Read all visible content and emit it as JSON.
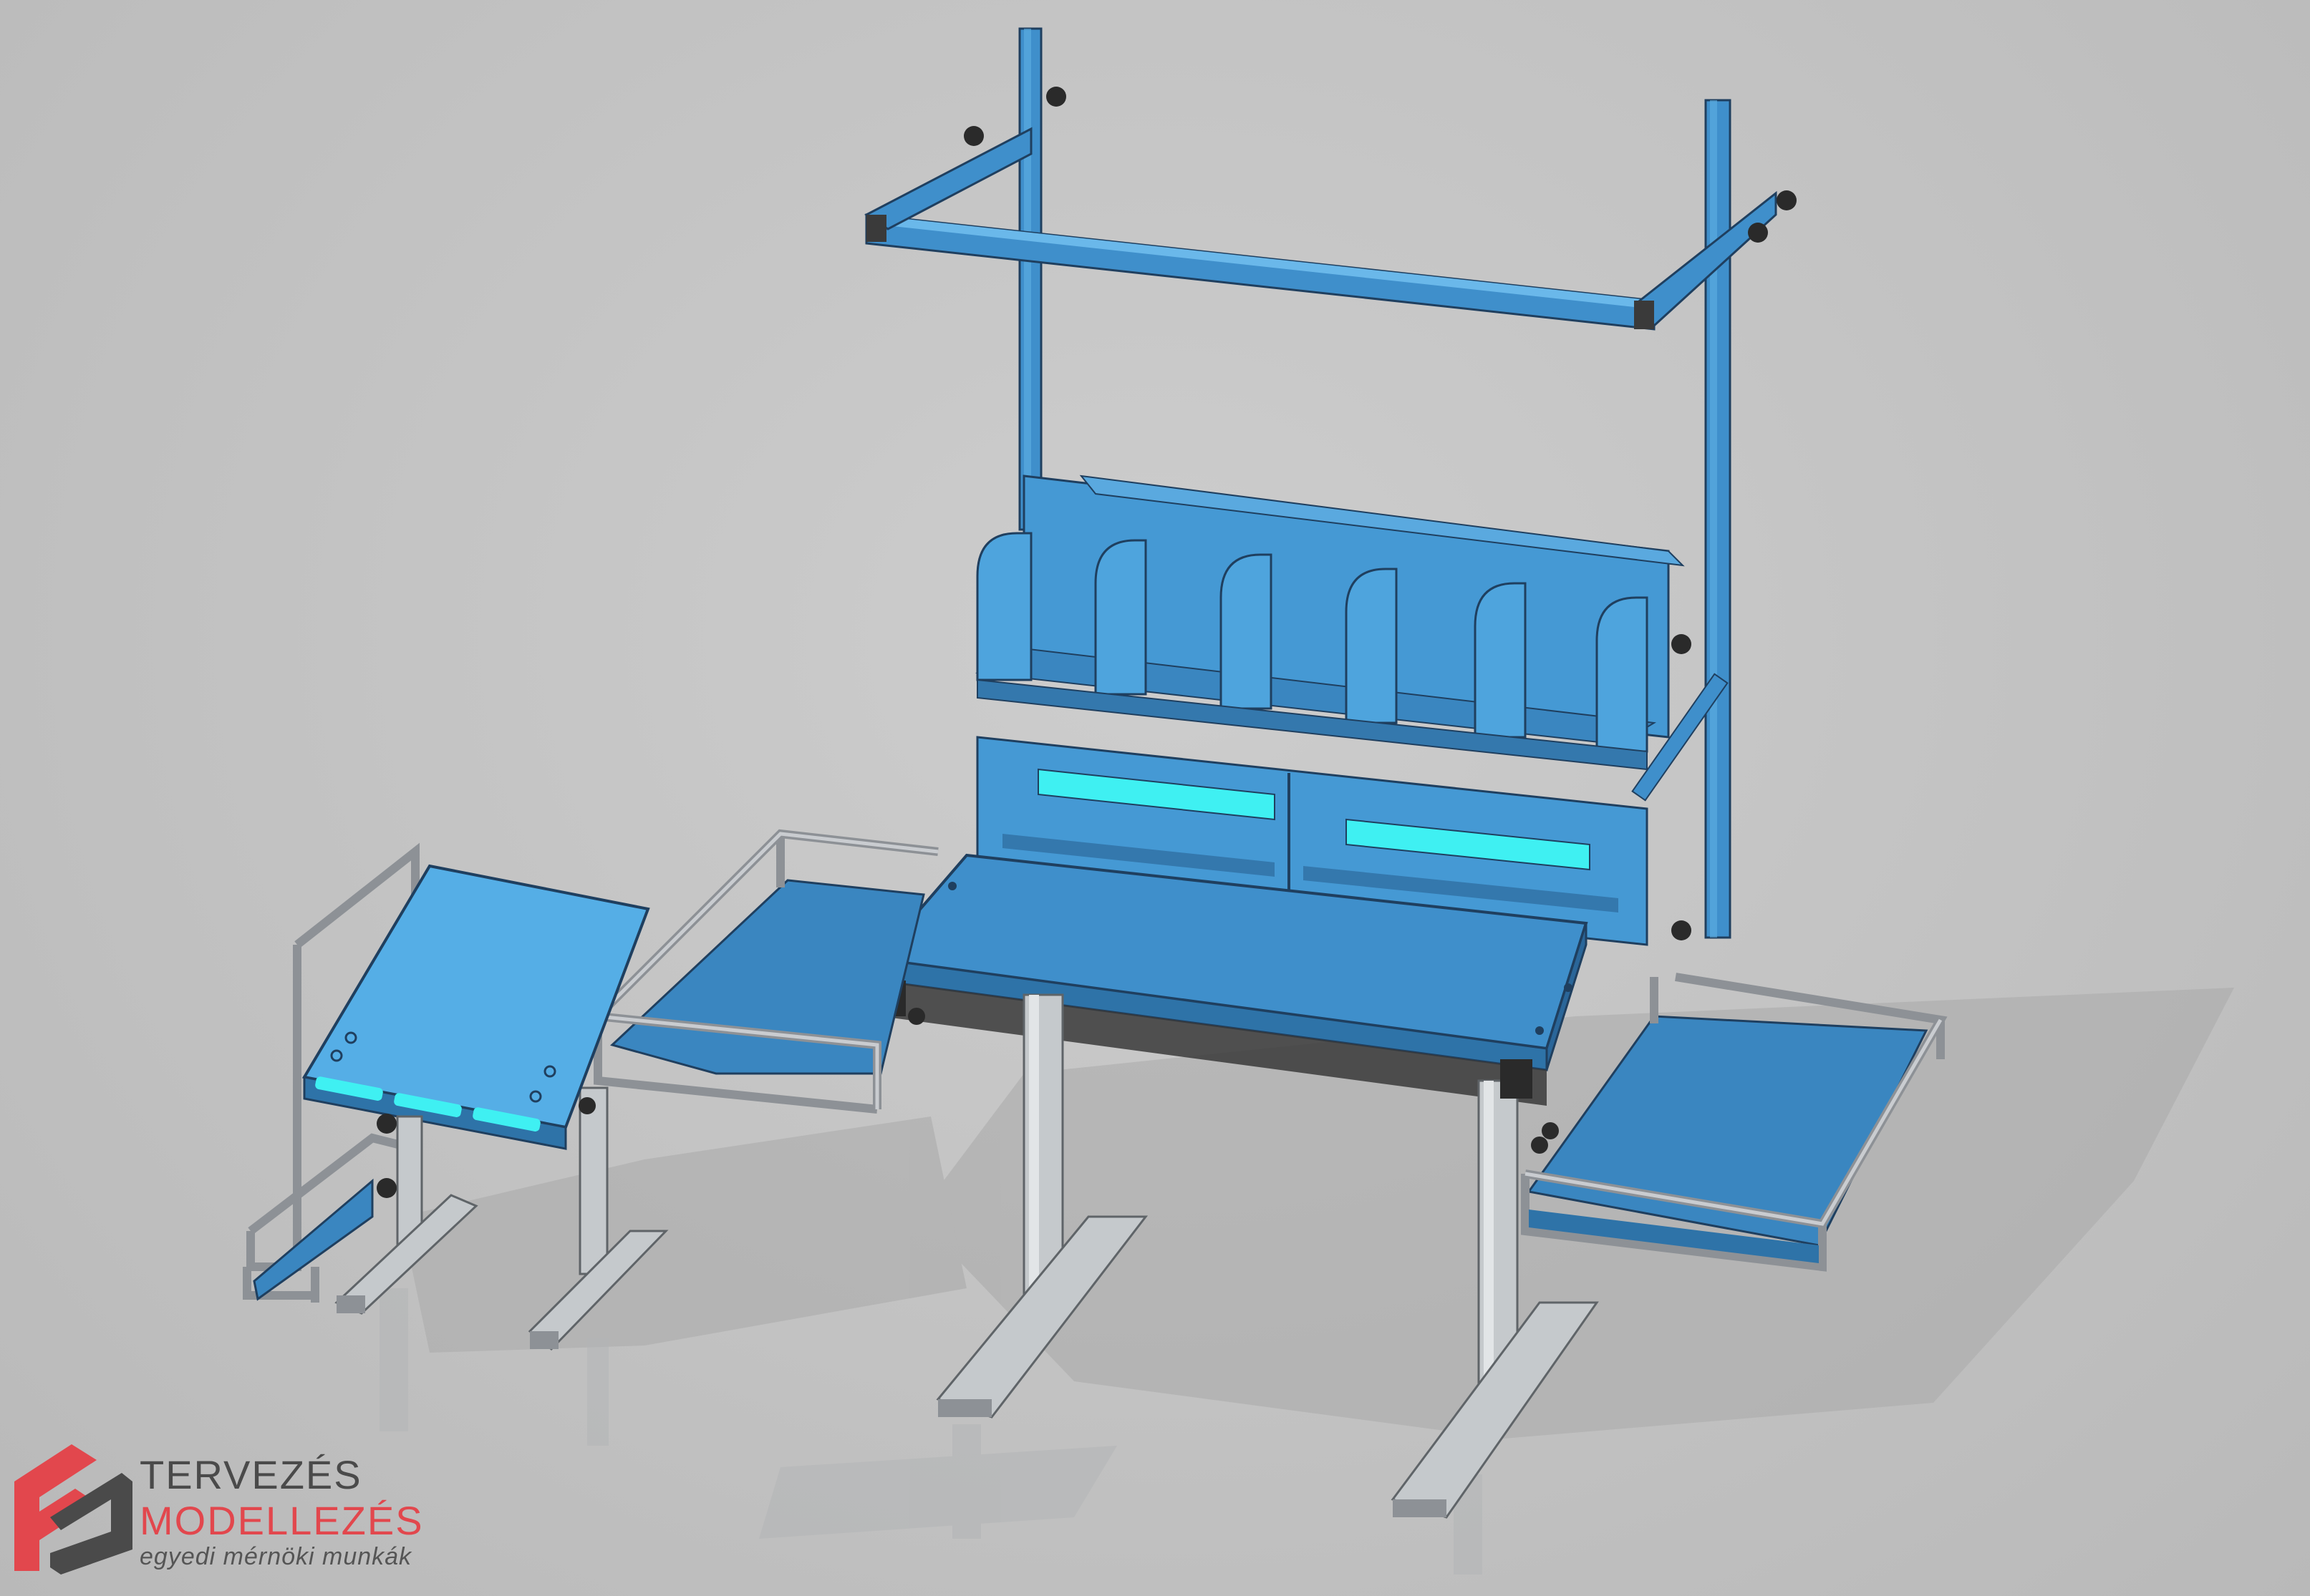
{
  "brand": {
    "line1": "TERVEZÉS",
    "line2": "MODELLEZÉS",
    "line3": "egyedi mérnöki munkák",
    "logo_icon": "fm-monogram-icon"
  },
  "colors": {
    "background": "#c4c4c4",
    "panel_blue": "#3f8fcb",
    "panel_blue_light": "#55aee6",
    "panel_blue_dark": "#2e73a8",
    "frame_grey": "#b8bcc0",
    "frame_grey_dark": "#8d9196",
    "led_cyan": "#3ff0f2",
    "brand_red": "#e2474d",
    "brand_grey": "#4a4a4a",
    "knob_black": "#2a2a2a"
  }
}
